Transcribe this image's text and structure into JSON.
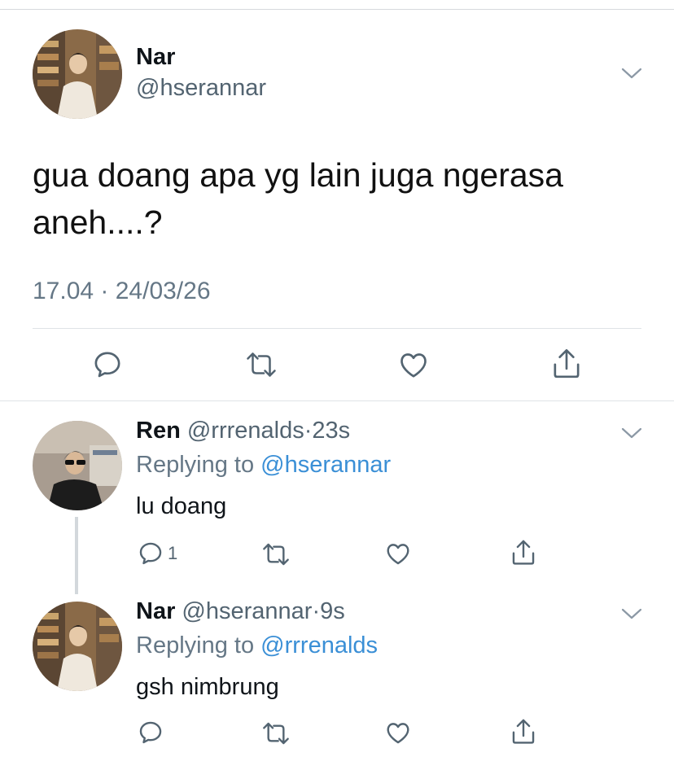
{
  "main_tweet": {
    "display_name": "Nar",
    "handle": "@hserannar",
    "text": "gua doang apa yg lain juga ngerasa aneh....?",
    "timestamp": "17.04 · 24/03/26",
    "icons": {
      "more": "chevron-down-icon",
      "reply": "reply-icon",
      "retweet": "retweet-icon",
      "like": "heart-icon",
      "share": "share-icon"
    }
  },
  "replies": [
    {
      "display_name": "Ren",
      "handle": "@rrrenalds",
      "separator": "·",
      "time": "23s",
      "replying_prefix": "Replying to",
      "replying_to": "@hserannar",
      "text": "lu doang",
      "reply_count": "1"
    },
    {
      "display_name": "Nar",
      "handle": "@hserannar",
      "separator": "·",
      "time": "9s",
      "replying_prefix": "Replying to",
      "replying_to": "@rrrenalds",
      "text": "gsh nimbrung",
      "reply_count": ""
    }
  ],
  "colors": {
    "text": "#0f1419",
    "secondary": "#536471",
    "mention": "#3a8fd6",
    "divider": "#dfe3e6"
  }
}
